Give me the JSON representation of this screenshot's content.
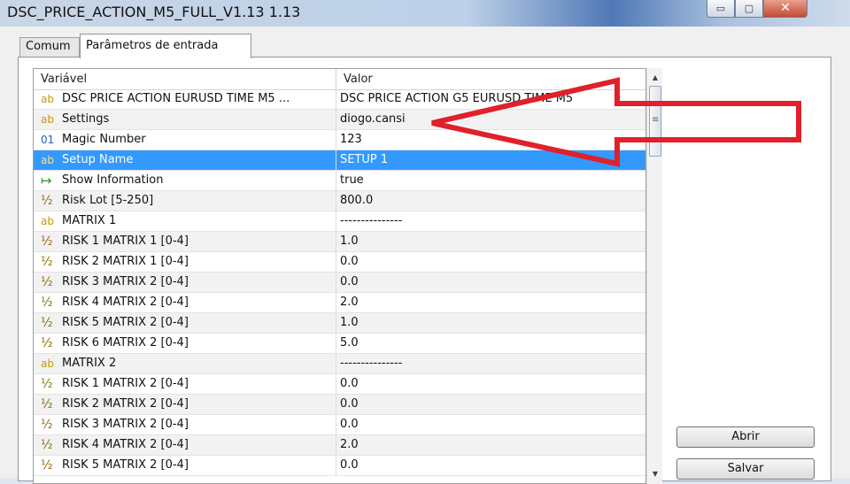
{
  "window": {
    "title": "DSC_PRICE_ACTION_M5_FULL_V1.13 1.13",
    "controls": {
      "minimize": "▭",
      "maximize": "▢",
      "close": "✕"
    }
  },
  "tabs": [
    {
      "label": "Comum",
      "active": false
    },
    {
      "label": "Parâmetros de entrada",
      "active": true
    }
  ],
  "grid": {
    "columns": {
      "variable": "Variável",
      "value": "Valor"
    },
    "rows": [
      {
        "icon": "ab",
        "type": "string",
        "name": "DSC PRICE ACTION EURUSD TIME M5 ...",
        "value": "DSC PRICE ACTION G5 EURUSD TIME M5"
      },
      {
        "icon": "ab",
        "type": "string",
        "name": "Settings",
        "value": "diogo.cansi"
      },
      {
        "icon": "01",
        "type": "int",
        "name": "Magic Number",
        "value": "123"
      },
      {
        "icon": "ab",
        "type": "string",
        "name": "Setup Name",
        "value": "SETUP 1",
        "selected": true
      },
      {
        "icon": "↦",
        "type": "bool",
        "name": "Show Information",
        "value": "true"
      },
      {
        "icon": "½",
        "type": "double",
        "name": "Risk Lot [5-250]",
        "value": "800.0"
      },
      {
        "icon": "ab",
        "type": "string",
        "name": "MATRIX 1",
        "value": "---------------"
      },
      {
        "icon": "½",
        "type": "double",
        "name": "RISK 1 MATRIX 1 [0-4]",
        "value": "1.0"
      },
      {
        "icon": "½",
        "type": "double",
        "name": "RISK 2 MATRIX 1 [0-4]",
        "value": "0.0"
      },
      {
        "icon": "½",
        "type": "double",
        "name": "RISK 3 MATRIX 2 [0-4]",
        "value": "0.0"
      },
      {
        "icon": "½",
        "type": "double",
        "name": "RISK 4 MATRIX 2 [0-4]",
        "value": "2.0"
      },
      {
        "icon": "½",
        "type": "double",
        "name": "RISK 5 MATRIX 2 [0-4]",
        "value": "1.0"
      },
      {
        "icon": "½",
        "type": "double",
        "name": "RISK 6 MATRIX 2 [0-4]",
        "value": "5.0"
      },
      {
        "icon": "ab",
        "type": "string",
        "name": "MATRIX 2",
        "value": "---------------"
      },
      {
        "icon": "½",
        "type": "double",
        "name": "RISK 1 MATRIX 2 [0-4]",
        "value": "0.0"
      },
      {
        "icon": "½",
        "type": "double",
        "name": "RISK 2 MATRIX 2 [0-4]",
        "value": "0.0"
      },
      {
        "icon": "½",
        "type": "double",
        "name": "RISK 3 MATRIX 2 [0-4]",
        "value": "0.0"
      },
      {
        "icon": "½",
        "type": "double",
        "name": "RISK 4 MATRIX 2 [0-4]",
        "value": "2.0"
      },
      {
        "icon": "½",
        "type": "double",
        "name": "RISK 5 MATRIX 2 [0-4]",
        "value": "0.0"
      }
    ]
  },
  "scrollbar": {
    "up": "▲",
    "down": "▼",
    "grip": "≡"
  },
  "buttons": {
    "open": "Abrir",
    "save": "Salvar"
  },
  "colors": {
    "selection": "#3399ff",
    "annotation_arrow": "#e0202a"
  }
}
